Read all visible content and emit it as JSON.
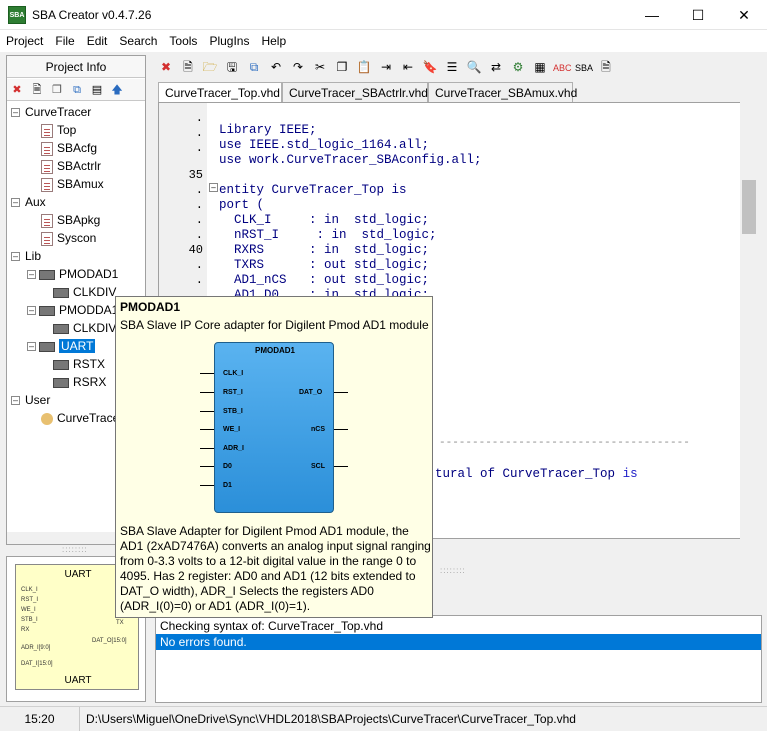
{
  "window": {
    "title": "SBA Creator v0.4.7.26",
    "icon_text": "SBA",
    "minimize_icon": "minimize-icon",
    "maximize_icon": "maximize-icon",
    "close_icon": "close-icon"
  },
  "menu": [
    "Project",
    "File",
    "Edit",
    "Search",
    "Tools",
    "PlugIns",
    "Help"
  ],
  "left_panel": {
    "header": "Project Info",
    "tree": [
      {
        "label": "CurveTracer",
        "kind": "group"
      },
      {
        "label": "Top",
        "kind": "file"
      },
      {
        "label": "SBAcfg",
        "kind": "file"
      },
      {
        "label": "SBActrlr",
        "kind": "file"
      },
      {
        "label": "SBAmux",
        "kind": "file"
      },
      {
        "label": "Aux",
        "kind": "group"
      },
      {
        "label": "SBApkg",
        "kind": "file"
      },
      {
        "label": "Syscon",
        "kind": "file"
      },
      {
        "label": "Lib",
        "kind": "group"
      },
      {
        "label": "PMODAD1",
        "kind": "chip"
      },
      {
        "label": "CLKDIV",
        "kind": "chip"
      },
      {
        "label": "PMODDA1",
        "kind": "chip"
      },
      {
        "label": "CLKDIV",
        "kind": "chip"
      },
      {
        "label": "UART",
        "kind": "chip"
      },
      {
        "label": "RSTX",
        "kind": "chip"
      },
      {
        "label": "RSRX",
        "kind": "chip"
      },
      {
        "label": "User",
        "kind": "group"
      },
      {
        "label": "CurveTracer",
        "kind": "user"
      }
    ]
  },
  "preview": {
    "title": "UART",
    "footer": "UART",
    "pins_left": [
      "CLK_I",
      "RST_I",
      "WE_I",
      "STB_I",
      "RX",
      "ADR_I[9:0]",
      "DAT_I[15:0]"
    ],
    "pins_right": [
      "TX",
      "DAT_O[15:0]"
    ]
  },
  "tabs": [
    "CurveTracer_Top.vhd",
    "CurveTracer_SBActrlr.vhd",
    "CurveTracer_SBAmux.vhd"
  ],
  "editor": {
    "gutter": [
      ".",
      ".",
      ".",
      "35",
      ".",
      ".",
      ".",
      ".",
      "40",
      ".",
      ".",
      "."
    ],
    "lines": [
      "",
      "Library IEEE;",
      "use IEEE.std_logic_1164.all;",
      "use work.CurveTracer_SBAconfig.all;",
      "",
      "entity CurveTracer_Top is",
      "port (",
      "  CLK_I     : in  std_logic;",
      "  nRST_I     : in  std_logic;",
      "  RXRS      : in  std_logic;",
      "  TXRS      : out std_logic;",
      "  AD1_nCS   : out std_logic;",
      "  AD1_D0    : in  std_logic;"
    ],
    "frag_dashes": "--------------------------------------",
    "frag_arch_prefix": "tural of ",
    "frag_arch_entity": "CurveTracer_Top",
    "frag_arch_is": "is"
  },
  "tooltip": {
    "title": "PMODAD1",
    "subtitle": "SBA Slave IP Core adapter for Digilent Pmod AD1 module",
    "block_label": "PMODAD1",
    "pins_in": [
      "CLK_I",
      "RST_I",
      "STB_I",
      "WE_I",
      "ADR_I",
      "D0",
      "D1"
    ],
    "pins_out": [
      "DAT_O",
      "nCS",
      "SCL"
    ],
    "description": "SBA Slave Adapter for Digilent Pmod AD1 module, the AD1 (2xAD7476A) converts an analog input signal ranging from 0-3.3 volts to a 12-bit digital value in the range 0 to 4095. Has 2 register: AD0 and AD1 (12 bits extended to DAT_O width), ADR_I Selects the registers AD0 (ADR_I(0)=0) or AD1 (ADR_I(0)=1)."
  },
  "output": {
    "lines": [
      "Checking syntax of: CurveTracer_Top.vhd",
      "No errors found."
    ],
    "selected_index": 1,
    "selected_color": "#0078d7"
  },
  "status": {
    "time": "15:20",
    "path": "D:\\Users\\Miguel\\OneDrive\\Sync\\VHDL2018\\SBAProjects\\CurveTracer\\CurveTracer_Top.vhd"
  }
}
